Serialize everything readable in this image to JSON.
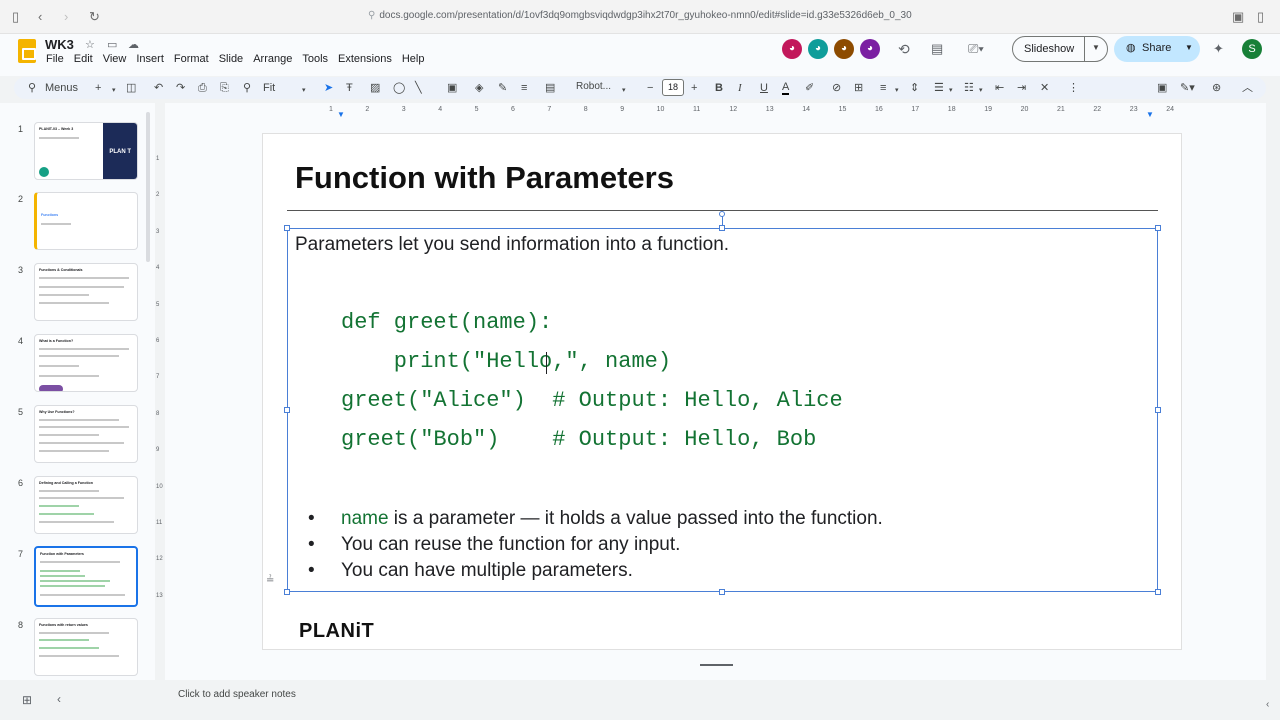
{
  "browser": {
    "url": "docs.google.com/presentation/d/1ovf3dq9omgbsviqdwdgp3ihx2t70r_gyuhokeo-nmn0/edit#slide=id.g33e5326d6eb_0_30"
  },
  "app": {
    "doc_title": "WK3",
    "menus": [
      "File",
      "Edit",
      "View",
      "Insert",
      "Format",
      "Slide",
      "Arrange",
      "Tools",
      "Extensions",
      "Help"
    ],
    "slideshow_label": "Slideshow",
    "share_label": "Share",
    "user_initial": "S"
  },
  "toolbar": {
    "menus_label": "Menus",
    "zoom_label": "Fit",
    "font_name": "Robot...",
    "font_size": "18"
  },
  "ruler": {
    "ticks": [
      "1",
      "2",
      "3",
      "4",
      "5",
      "6",
      "7",
      "8",
      "9",
      "10",
      "11",
      "12",
      "13",
      "14",
      "15",
      "16",
      "17",
      "18",
      "19",
      "20",
      "21",
      "22",
      "23",
      "24"
    ]
  },
  "vruler": {
    "ticks": [
      "1",
      "2",
      "3",
      "4",
      "5",
      "6",
      "7",
      "8",
      "9",
      "10",
      "11",
      "12",
      "13"
    ]
  },
  "filmstrip": {
    "slides": [
      {
        "number": "1",
        "title": "PLANIT-03 – Week 3"
      },
      {
        "number": "2",
        "title": "Functions"
      },
      {
        "number": "3",
        "title": "Functions & Conditionals"
      },
      {
        "number": "4",
        "title": "What is a Function?"
      },
      {
        "number": "5",
        "title": "Why Use Functions?"
      },
      {
        "number": "6",
        "title": "Defining and Calling a Function"
      },
      {
        "number": "7",
        "title": "Function with Parameters"
      },
      {
        "number": "8",
        "title": "Functions with return values"
      }
    ],
    "thumb1_badge": "PLAN T"
  },
  "slide": {
    "title": "Function with Parameters",
    "intro": "Parameters let you send information into a function.",
    "code": [
      "def greet(name):",
      "    print(\"Hello,\", name)",
      "greet(\"Alice\")  # Output: Hello, Alice",
      "greet(\"Bob\")    # Output: Hello, Bob"
    ],
    "bullets": [
      {
        "keyword": "name",
        "text": " is a parameter — it holds a value passed into the function."
      },
      {
        "keyword": "",
        "text": "You can reuse the function for any input."
      },
      {
        "keyword": "",
        "text": "You can have multiple parameters."
      }
    ],
    "brand": "PLANiT"
  },
  "notes": {
    "placeholder": "Click to add speaker notes"
  },
  "colors": {
    "code_green": "#137333",
    "selection_blue": "#4a7fd6",
    "share_bg": "#c2e7ff"
  }
}
